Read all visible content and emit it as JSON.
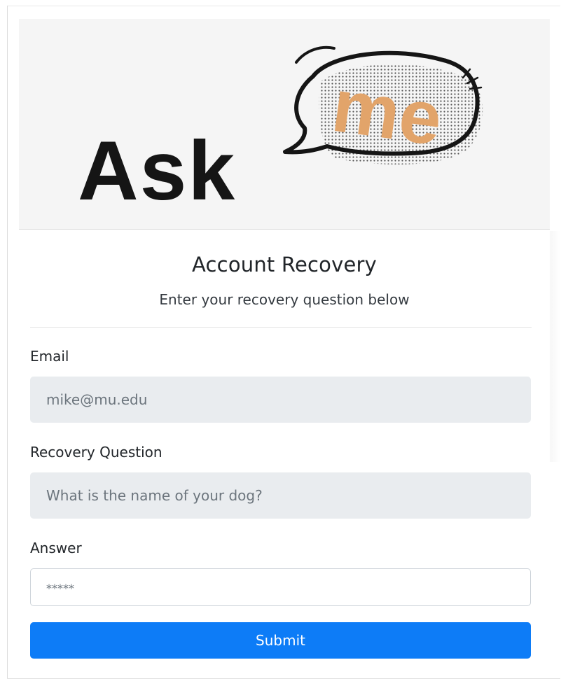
{
  "logo": {
    "text_left": "Ask",
    "text_bubble": "me",
    "colors": {
      "ask": "#151515",
      "me": "#e2a46a",
      "bubble_outline": "#151515",
      "banner_bg": "#f5f5f5"
    }
  },
  "header": {
    "title": "Account Recovery",
    "subtitle": "Enter your recovery question below"
  },
  "form": {
    "email": {
      "label": "Email",
      "value": "mike@mu.edu"
    },
    "question": {
      "label": "Recovery Question",
      "value": "What is the name of your dog?"
    },
    "answer": {
      "label": "Answer",
      "placeholder": "*****"
    },
    "submit_label": "Submit"
  },
  "colors": {
    "primary": "#0d7cf7",
    "readonly_bg": "#e9ecef",
    "text": "#212529",
    "muted": "#6c757d"
  }
}
